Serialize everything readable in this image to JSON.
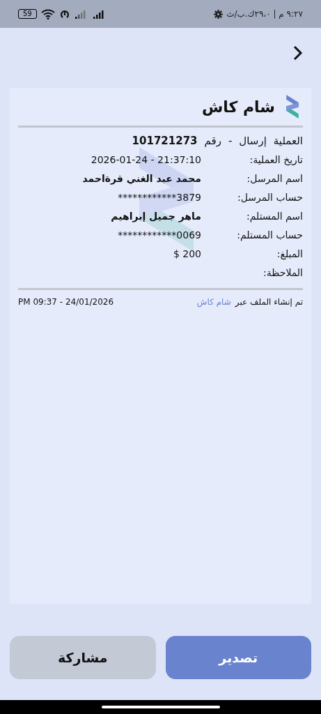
{
  "status_bar": {
    "time_and_speed": "٩:٢٧ م | ٢٩،٠ك.ب/ث",
    "battery": "59"
  },
  "receipt": {
    "brand": "شام كاش",
    "operation": {
      "label": "العملية",
      "type": "إرسال",
      "separator": "-",
      "number_label": "رقم",
      "number": "101721273"
    },
    "fields": [
      {
        "label": "تاريخ العملية:",
        "value": "2026-01-24 - 21:37:10",
        "bold": false
      },
      {
        "label": "اسم المرسل:",
        "value": "محمد عبد الغني قرةاحمد",
        "bold": true
      },
      {
        "label": "حساب المرسل:",
        "value": "************3879",
        "bold": false
      },
      {
        "label": "اسم المستلم:",
        "value": "ماهر جميل إبراهيم",
        "bold": true
      },
      {
        "label": "حساب المستلم:",
        "value": "************0069",
        "bold": false
      },
      {
        "label": "المبلغ:",
        "value": "$ 200",
        "bold": false
      },
      {
        "label": "الملاحظة:"
      }
    ],
    "footer": {
      "created_via": "تم إنشاء الملف عبر",
      "app_link": "شام كاش",
      "timestamp": "PM 09:37 - 24/01/2026"
    }
  },
  "buttons": [
    {
      "label": "تصدير",
      "kind": "primary"
    },
    {
      "label": "مشاركة",
      "kind": "secondary"
    }
  ]
}
